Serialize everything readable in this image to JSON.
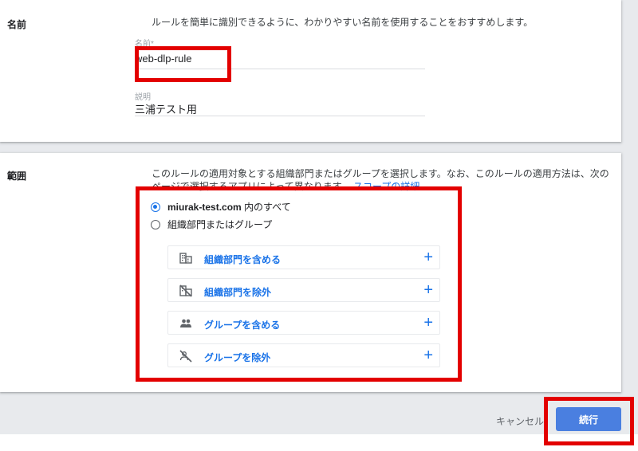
{
  "name_section": {
    "label": "名前",
    "description": "ルールを簡単に識別できるように、わかりやすい名前を使用することをおすすめします。",
    "name_field": {
      "label": "名前*",
      "value": "web-dlp-rule"
    },
    "desc_field": {
      "label": "説明",
      "value": "三浦テスト用"
    }
  },
  "scope_section": {
    "label": "範囲",
    "description_line1": "このルールの適用対象とする組織部門またはグループを選択します。なお、このルールの適用方法は、次の",
    "description_line2": "ページで選択するアプリによって異なります。",
    "link": "スコープの詳細",
    "radio_all_domain": "miurak-test.com",
    "radio_all_suffix": " 内のすべて",
    "radio_ou_group": "組織部門またはグループ",
    "rows": [
      {
        "label": "組織部門を含める",
        "icon": "building-icon"
      },
      {
        "label": "組織部門を除外",
        "icon": "building-off-icon"
      },
      {
        "label": "グループを含める",
        "icon": "group-icon"
      },
      {
        "label": "グループを除外",
        "icon": "group-off-icon"
      }
    ]
  },
  "footer": {
    "cancel_label": "キャンセル",
    "continue_label": "続行"
  },
  "colors": {
    "accent": "#1a73e8",
    "primary_button": "#4a7fe0",
    "highlight": "#e30000"
  }
}
